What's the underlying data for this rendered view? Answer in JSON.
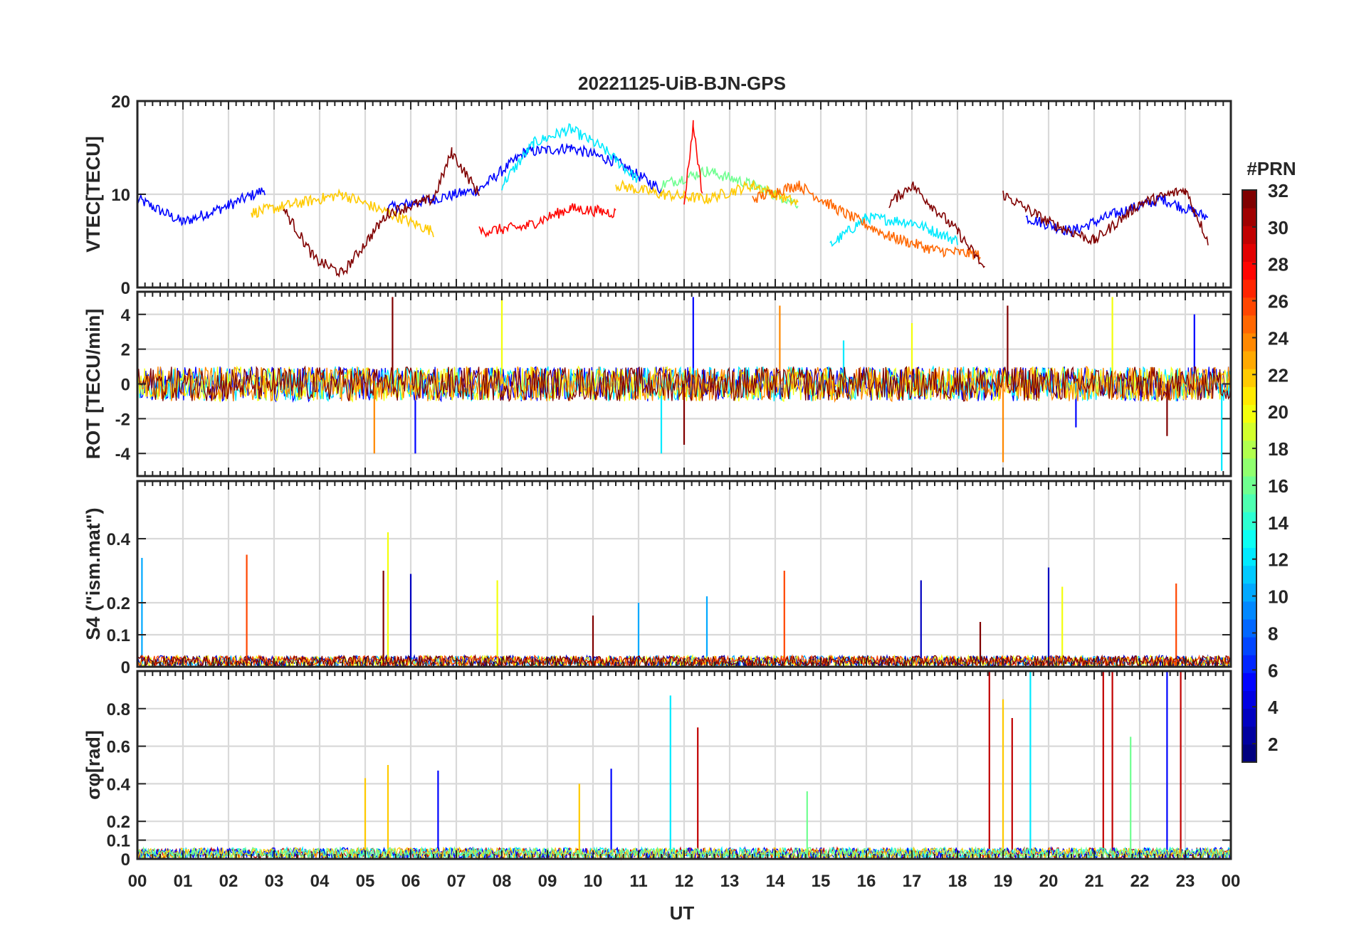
{
  "figure": {
    "title": "20221125-UiB-BJN-GPS"
  },
  "colorbar": {
    "title": "#PRN",
    "range": [
      1,
      32
    ],
    "ticks": [
      2,
      4,
      6,
      8,
      10,
      12,
      14,
      16,
      18,
      20,
      22,
      24,
      26,
      28,
      30,
      32
    ],
    "tick_labels": [
      "2",
      "4",
      "6",
      "8",
      "10",
      "12",
      "14",
      "16",
      "18",
      "20",
      "22",
      "24",
      "26",
      "28",
      "30",
      "32"
    ],
    "colormap": "jet",
    "levels": 32
  },
  "chart_data": [
    {
      "type": "line",
      "panel": "vtec",
      "title": "20221125-UiB-BJN-GPS",
      "ylabel": "VTEC[TECU]",
      "xlabel": "",
      "xlim": [
        0,
        24
      ],
      "ylim": [
        0,
        20
      ],
      "yticks": [
        0,
        10,
        20
      ],
      "ytick_labels": [
        "0",
        "10",
        "20"
      ],
      "grid": true,
      "color_by": "PRN",
      "series": [
        {
          "prn": 5,
          "segments": [
            {
              "x": [
                0.0,
                1.0,
                2.0,
                2.8
              ],
              "y": [
                9.5,
                7.0,
                8.8,
                10.5
              ]
            },
            {
              "x": [
                5.5,
                6.5,
                7.5,
                8.5,
                9.5,
                10.5,
                11.5
              ],
              "y": [
                8.5,
                9.5,
                10.5,
                14.5,
                15.0,
                13.5,
                10.5
              ]
            },
            {
              "x": [
                19.5,
                20.5,
                21.5,
                22.5,
                23.5
              ],
              "y": [
                7.5,
                6.0,
                8.0,
                9.5,
                7.5
              ]
            }
          ]
        },
        {
          "prn": 12,
          "segments": [
            {
              "x": [
                8.0,
                8.7,
                9.5,
                10.2,
                11.0
              ],
              "y": [
                11.0,
                15.5,
                17.0,
                15.0,
                11.5
              ]
            },
            {
              "x": [
                15.2,
                16.0,
                17.0,
                18.0
              ],
              "y": [
                4.5,
                7.5,
                7.0,
                5.0
              ]
            }
          ]
        },
        {
          "prn": 16,
          "segments": [
            {
              "x": [
                11.5,
                12.5,
                13.5,
                14.5
              ],
              "y": [
                11.0,
                12.5,
                11.0,
                9.0
              ]
            }
          ]
        },
        {
          "prn": 22,
          "segments": [
            {
              "x": [
                2.5,
                3.5,
                4.5,
                5.5,
                6.5
              ],
              "y": [
                8.0,
                9.0,
                10.0,
                8.0,
                6.0
              ]
            },
            {
              "x": [
                10.5,
                11.5,
                12.5,
                13.5,
                14.5
              ],
              "y": [
                11.0,
                10.0,
                9.5,
                11.0,
                9.0
              ]
            }
          ]
        },
        {
          "prn": 25,
          "segments": [
            {
              "x": [
                13.5,
                14.5,
                15.5,
                16.5,
                17.5,
                18.5
              ],
              "y": [
                9.5,
                11.0,
                8.0,
                5.5,
                4.0,
                3.5
              ]
            }
          ]
        },
        {
          "prn": 28,
          "segments": [
            {
              "x": [
                7.5,
                8.5,
                9.5,
                10.5
              ],
              "y": [
                6.0,
                6.5,
                8.5,
                8.0
              ]
            },
            {
              "x": [
                12.0,
                12.2,
                12.4
              ],
              "y": [
                9.0,
                17.5,
                10.0
              ]
            }
          ]
        },
        {
          "prn": 32,
          "segments": [
            {
              "x": [
                3.2,
                3.9,
                4.5,
                5.5,
                6.5,
                6.9,
                7.5
              ],
              "y": [
                8.5,
                3.0,
                1.5,
                8.0,
                9.5,
                14.5,
                10.0
              ]
            },
            {
              "x": [
                16.5,
                17.0,
                18.0,
                18.6
              ],
              "y": [
                9.0,
                11.0,
                6.0,
                2.0
              ]
            },
            {
              "x": [
                19.0,
                20.0,
                21.0,
                22.0,
                23.0,
                23.5
              ],
              "y": [
                10.0,
                7.0,
                5.0,
                9.0,
                10.5,
                5.0
              ]
            }
          ]
        }
      ]
    },
    {
      "type": "line",
      "panel": "rot",
      "ylabel": "ROT [TECU/min]",
      "xlabel": "",
      "xlim": [
        0,
        24
      ],
      "ylim": [
        -5.3,
        5.3
      ],
      "yticks": [
        -4,
        -2,
        0,
        2,
        4
      ],
      "ytick_labels": [
        "-4",
        "-2",
        "0",
        "2",
        "4"
      ],
      "grid": true,
      "color_by": "PRN",
      "series": [
        {
          "prn": 5,
          "peaks": [
            {
              "x": 6.1,
              "y": -4.0
            },
            {
              "x": 12.2,
              "y": 5.0
            },
            {
              "x": 20.6,
              "y": -2.5
            },
            {
              "x": 23.2,
              "y": 4.0
            }
          ]
        },
        {
          "prn": 12,
          "peaks": [
            {
              "x": 11.5,
              "y": -4.0
            },
            {
              "x": 15.5,
              "y": 2.5
            },
            {
              "x": 23.8,
              "y": -5.0
            }
          ]
        },
        {
          "prn": 20,
          "peaks": [
            {
              "x": 8.0,
              "y": 5.0
            },
            {
              "x": 17.0,
              "y": 3.5
            },
            {
              "x": 21.4,
              "y": 5.0
            }
          ]
        },
        {
          "prn": 24,
          "peaks": [
            {
              "x": 5.2,
              "y": -4.0
            },
            {
              "x": 14.1,
              "y": 4.5
            },
            {
              "x": 19.0,
              "y": -4.5
            }
          ]
        },
        {
          "prn": 32,
          "peaks": [
            {
              "x": 5.6,
              "y": 5.0
            },
            {
              "x": 12.0,
              "y": -3.5
            },
            {
              "x": 19.1,
              "y": 4.5
            },
            {
              "x": 22.6,
              "y": -3.0
            }
          ]
        }
      ]
    },
    {
      "type": "line",
      "panel": "s4",
      "ylabel": "S4 (\"ism.mat\")",
      "xlabel": "",
      "xlim": [
        0,
        24
      ],
      "ylim": [
        0,
        0.58
      ],
      "yticks": [
        0,
        0.1,
        0.2,
        0.4
      ],
      "ytick_labels": [
        "0",
        "0.1",
        "0.2",
        "0.4"
      ],
      "grid": true,
      "color_by": "PRN",
      "series": [
        {
          "prn": 10,
          "peaks": [
            {
              "x": 0.1,
              "y": 0.34
            },
            {
              "x": 11.0,
              "y": 0.2
            },
            {
              "x": 12.5,
              "y": 0.22
            }
          ]
        },
        {
          "prn": 3,
          "peaks": [
            {
              "x": 6.0,
              "y": 0.29
            },
            {
              "x": 17.2,
              "y": 0.27
            },
            {
              "x": 20.0,
              "y": 0.31
            }
          ]
        },
        {
          "prn": 20,
          "peaks": [
            {
              "x": 5.5,
              "y": 0.42
            },
            {
              "x": 7.9,
              "y": 0.27
            },
            {
              "x": 20.3,
              "y": 0.25
            }
          ]
        },
        {
          "prn": 26,
          "peaks": [
            {
              "x": 2.4,
              "y": 0.35
            },
            {
              "x": 14.2,
              "y": 0.3
            },
            {
              "x": 22.8,
              "y": 0.26
            }
          ]
        },
        {
          "prn": 32,
          "peaks": [
            {
              "x": 5.4,
              "y": 0.3
            },
            {
              "x": 10.0,
              "y": 0.16
            },
            {
              "x": 18.5,
              "y": 0.14
            }
          ]
        }
      ]
    },
    {
      "type": "line",
      "panel": "sigma_phi",
      "ylabel": "σφ[rad]",
      "xlabel": "UT",
      "xlim": [
        0,
        24
      ],
      "ylim": [
        0,
        1.0
      ],
      "yticks": [
        0,
        0.1,
        0.2,
        0.4,
        0.6,
        0.8
      ],
      "ytick_labels": [
        "0",
        "0.1",
        "0.2",
        "0.4",
        "0.6",
        "0.8"
      ],
      "xticks": [
        0,
        1,
        2,
        3,
        4,
        5,
        6,
        7,
        8,
        9,
        10,
        11,
        12,
        13,
        14,
        15,
        16,
        17,
        18,
        19,
        20,
        21,
        22,
        23,
        24
      ],
      "xtick_labels": [
        "00",
        "01",
        "02",
        "03",
        "04",
        "05",
        "06",
        "07",
        "08",
        "09",
        "10",
        "11",
        "12",
        "13",
        "14",
        "15",
        "16",
        "17",
        "18",
        "19",
        "20",
        "21",
        "22",
        "23",
        "00"
      ],
      "grid": true,
      "color_by": "PRN",
      "series": [
        {
          "prn": 30,
          "peaks": [
            {
              "x": 18.7,
              "y": 1.0
            },
            {
              "x": 19.2,
              "y": 0.75
            },
            {
              "x": 21.2,
              "y": 1.0
            },
            {
              "x": 21.4,
              "y": 1.0
            },
            {
              "x": 22.9,
              "y": 1.0
            },
            {
              "x": 12.3,
              "y": 0.7
            }
          ]
        },
        {
          "prn": 12,
          "peaks": [
            {
              "x": 11.7,
              "y": 0.87
            },
            {
              "x": 19.6,
              "y": 1.0
            }
          ]
        },
        {
          "prn": 5,
          "peaks": [
            {
              "x": 6.6,
              "y": 0.47
            },
            {
              "x": 10.4,
              "y": 0.48
            },
            {
              "x": 22.6,
              "y": 1.0
            }
          ]
        },
        {
          "prn": 22,
          "peaks": [
            {
              "x": 5.0,
              "y": 0.43
            },
            {
              "x": 5.5,
              "y": 0.5
            },
            {
              "x": 9.7,
              "y": 0.4
            },
            {
              "x": 19.0,
              "y": 0.85
            }
          ]
        },
        {
          "prn": 16,
          "peaks": [
            {
              "x": 14.7,
              "y": 0.36
            },
            {
              "x": 21.8,
              "y": 0.65
            }
          ]
        }
      ]
    }
  ]
}
